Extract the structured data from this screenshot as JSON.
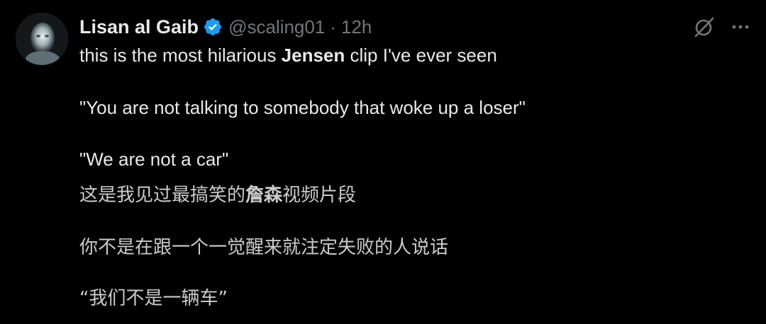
{
  "author": {
    "display_name": "Lisan al Gaib",
    "handle": "@scaling01",
    "separator": "·",
    "time": "12h",
    "verified": true,
    "verified_color": "#1d9bf0"
  },
  "icons": {
    "avatar": "avatar-image",
    "grok": "grok-slash-icon",
    "more": "more-horizontal-icon"
  },
  "tweet": {
    "line1_before": "this is the most hilarious ",
    "line1_bold": "Jensen",
    "line1_after": " clip I've ever seen",
    "quote1": "\"You are not talking to somebody that woke up a loser\"",
    "quote2": "\"We are not a car\"",
    "translation_before": "这是我见过最搞笑的",
    "translation_bold": "詹森",
    "translation_after": "视频片段",
    "translation_quote1": "你不是在跟一个一觉醒来就注定失败的人说话",
    "translation_quote2": "“我们不是一辆车”"
  },
  "colors": {
    "background": "#000000",
    "primary_text": "#e7e9ea",
    "secondary_text": "#71767b"
  }
}
